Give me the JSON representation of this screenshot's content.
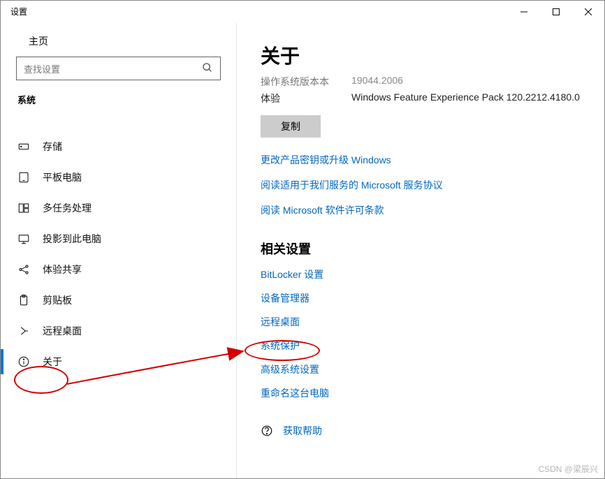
{
  "window": {
    "title": "设置"
  },
  "sidebar": {
    "home_label": "主页",
    "search_placeholder": "查找设置",
    "section_label": "系统",
    "items": [
      {
        "label": "存储",
        "icon": "storage-icon"
      },
      {
        "label": "平板电脑",
        "icon": "tablet-icon"
      },
      {
        "label": "多任务处理",
        "icon": "multitask-icon"
      },
      {
        "label": "投影到此电脑",
        "icon": "project-icon"
      },
      {
        "label": "体验共享",
        "icon": "share-icon"
      },
      {
        "label": "剪贴板",
        "icon": "clipboard-icon"
      },
      {
        "label": "远程桌面",
        "icon": "remote-icon"
      },
      {
        "label": "关于",
        "icon": "info-icon",
        "active": true
      }
    ]
  },
  "page": {
    "title": "关于",
    "truncated_row_label": "操作系统版本本",
    "truncated_row_value": "19044.2006",
    "experience_label": "体验",
    "experience_value": "Windows Feature Experience Pack 120.2212.4180.0",
    "copy_label": "复制",
    "links": [
      "更改产品密钥或升级 Windows",
      "阅读适用于我们服务的 Microsoft 服务协议",
      "阅读 Microsoft 软件许可条款"
    ],
    "related_heading": "相关设置",
    "related_links": [
      "BitLocker 设置",
      "设备管理器",
      "远程桌面",
      "系统保护",
      "高级系统设置",
      "重命名这台电脑"
    ],
    "help_label": "获取帮助"
  },
  "annotations": {
    "watermark": "CSDN @梁辰兴"
  }
}
